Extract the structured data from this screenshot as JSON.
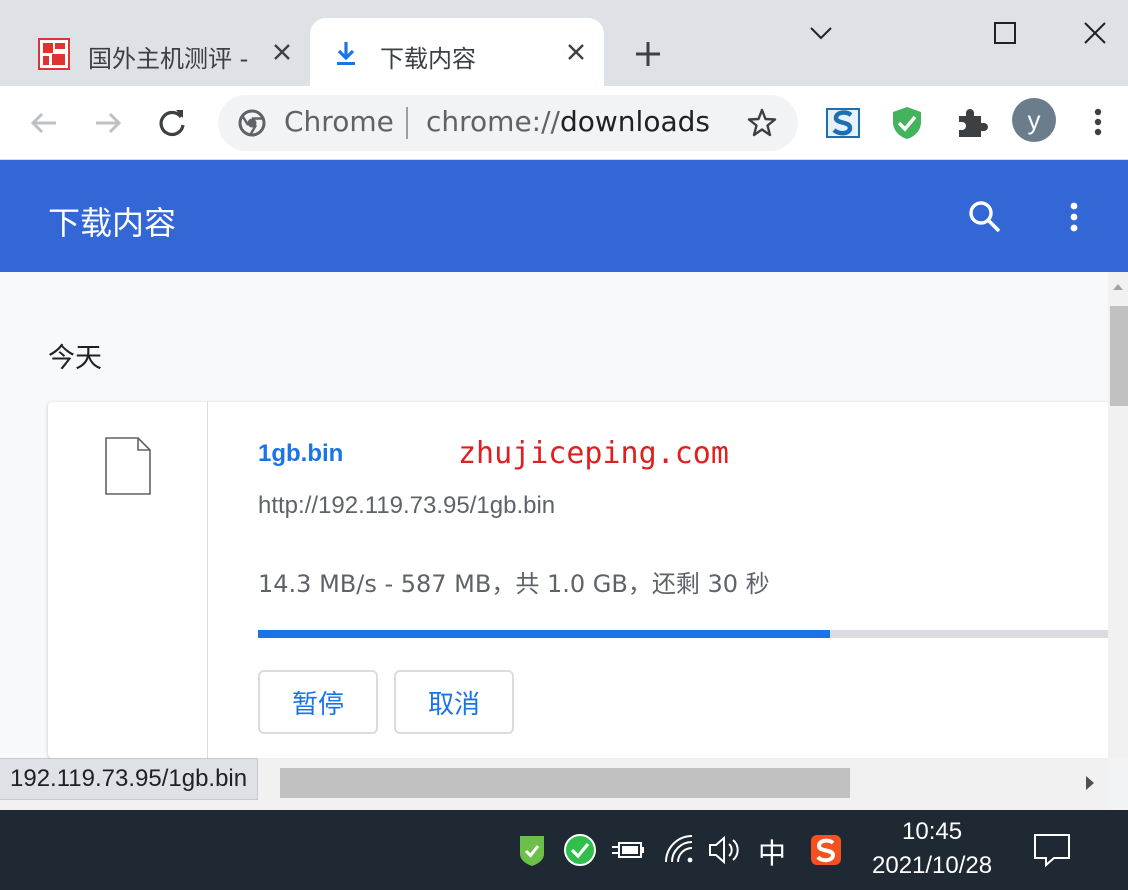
{
  "tabs": [
    {
      "title": "国外主机测评 - ",
      "active": false,
      "favicon": "zhujiceping-favicon"
    },
    {
      "title": "下载内容",
      "active": true,
      "favicon": "download-icon"
    }
  ],
  "toolbar": {
    "omnibox_chip": "Chrome",
    "url_scheme": "chrome://",
    "url_host": "downloads",
    "avatar_letter": "y",
    "extensions": [
      "s-extension-icon",
      "shield-extension-icon",
      "puzzle-icon"
    ]
  },
  "page": {
    "title": "下载内容",
    "date_heading": "今天"
  },
  "download": {
    "file_name": "1gb.bin",
    "watermark": "zhujiceping.com",
    "url": "http://192.119.73.95/1gb.bin",
    "status": "14.3 MB/s - 587 MB，共 1.0 GB，还剩 30 秒",
    "progress_percent": 65,
    "pause_label": "暂停",
    "cancel_label": "取消"
  },
  "status_bubble": "192.119.73.95/1gb.bin",
  "taskbar": {
    "ime": "中",
    "time": "10:45",
    "date": "2021/10/28"
  },
  "colors": {
    "header_blue": "#3367d6",
    "accent": "#1a73e8",
    "watermark_red": "#e02020"
  }
}
